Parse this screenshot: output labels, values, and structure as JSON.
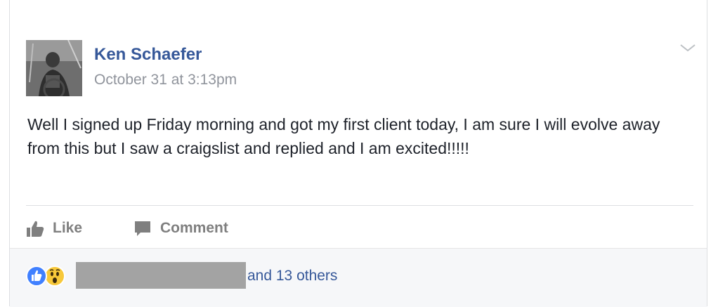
{
  "post": {
    "author": "Ken Schaefer",
    "timestamp": "October 31 at 3:13pm",
    "body": "Well I signed up Friday morning and got my first client today, I am sure I will evolve away from this but I saw a craigslist and replied and I am excited!!!!!"
  },
  "actions": {
    "like_label": "Like",
    "comment_label": "Comment"
  },
  "reactions": {
    "types": [
      "like-icon",
      "wow-icon"
    ],
    "others_text": "and 13 others"
  },
  "colors": {
    "link_blue": "#365899",
    "meta_gray": "#90949c",
    "reaction_blue": "#4080ff",
    "wow_yellow": "#f7c83a"
  }
}
